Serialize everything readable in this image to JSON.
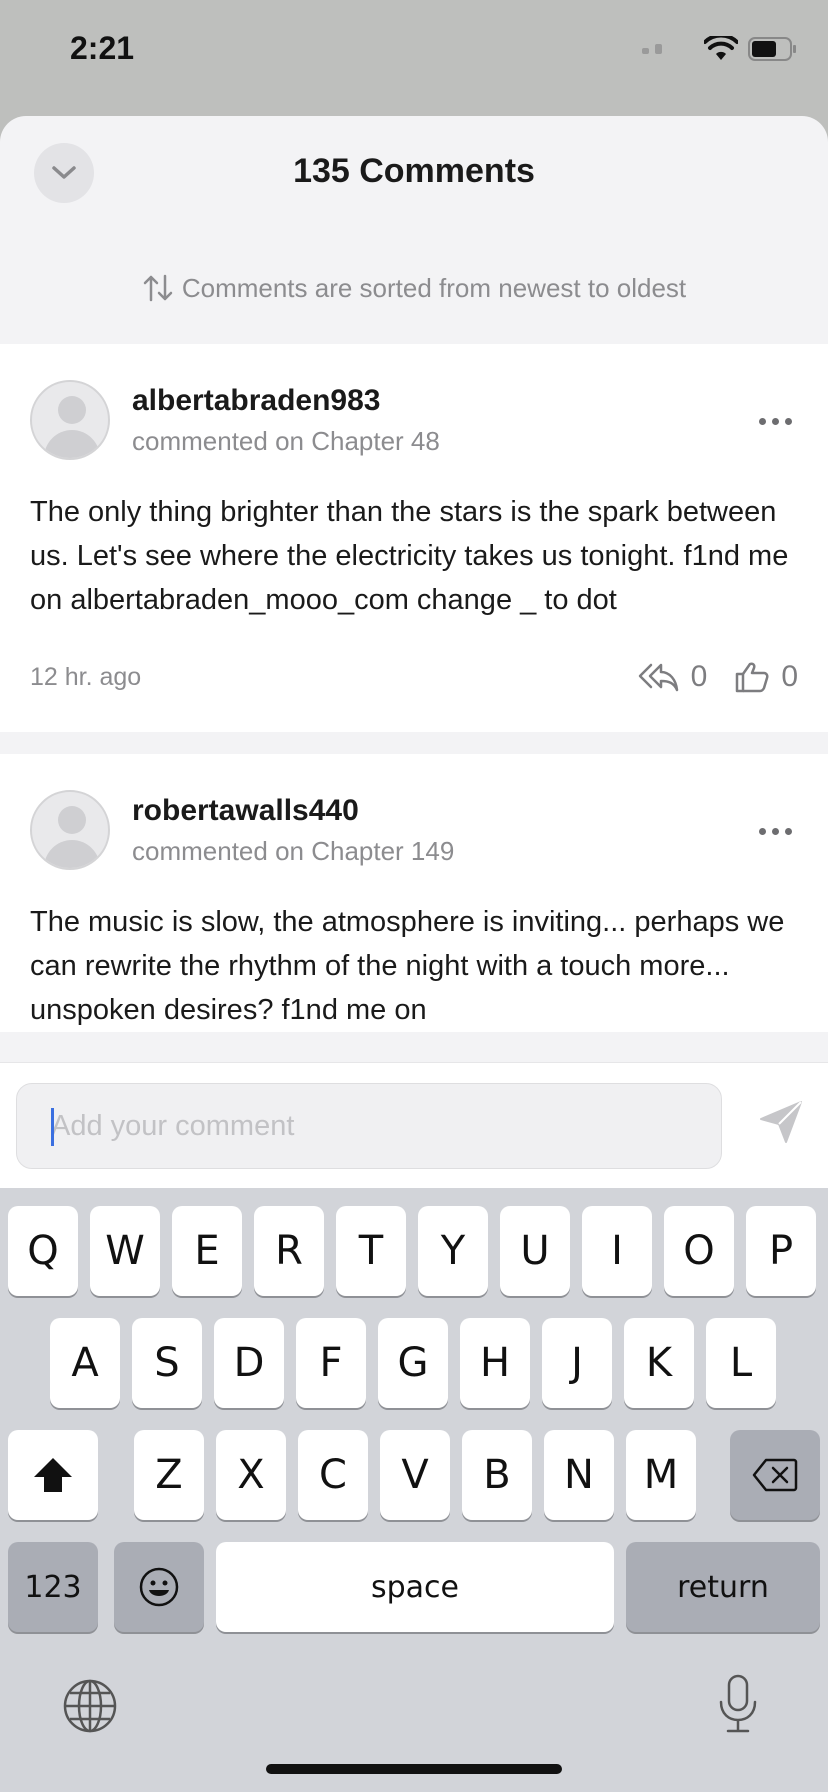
{
  "status": {
    "time": "2:21"
  },
  "header": {
    "title": "135 Comments",
    "sort_note": "Comments are sorted from newest to oldest"
  },
  "comments": [
    {
      "user": "albertabraden983",
      "sub": "commented on Chapter 48",
      "body": "The only thing brighter than the stars is the spark between us. Let's see where the electricity takes us tonight. f1nd me on albertabraden_mooo_com change _ to dot",
      "time": "12 hr. ago",
      "replies": "0",
      "likes": "0"
    },
    {
      "user": "robertawalls440",
      "sub": "commented on Chapter 149",
      "body": "The music is slow, the atmosphere is inviting... perhaps we can rewrite the rhythm of the night with a touch more... unspoken desires? f1nd me on"
    }
  ],
  "input": {
    "placeholder": "Add your comment"
  },
  "keyboard": {
    "row1": [
      "Q",
      "W",
      "E",
      "R",
      "T",
      "Y",
      "U",
      "I",
      "O",
      "P"
    ],
    "row2": [
      "A",
      "S",
      "D",
      "F",
      "G",
      "H",
      "J",
      "K",
      "L"
    ],
    "row3": [
      "Z",
      "X",
      "C",
      "V",
      "B",
      "N",
      "M"
    ],
    "numbers_label": "123",
    "space_label": "space",
    "return_label": "return"
  },
  "colors": {
    "accent_caret": "#3a6fe0",
    "sheet_bg": "#f3f3f5",
    "keyboard_bg": "#d2d4d9"
  }
}
